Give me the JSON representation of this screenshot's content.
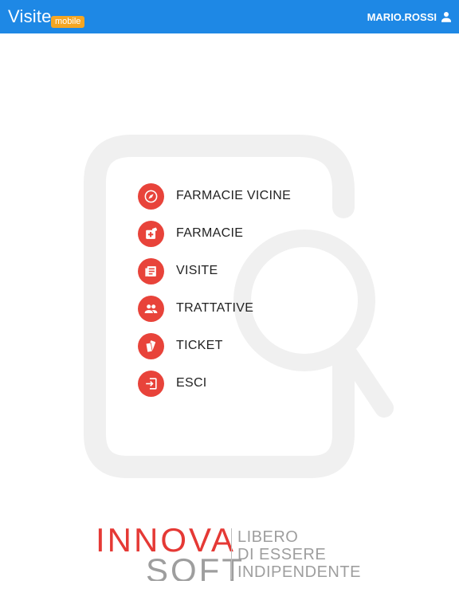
{
  "header": {
    "app_title": "Visite",
    "app_badge": "mobile",
    "username": "MARIO.ROSSI",
    "user_icon": "person-icon",
    "background_color": "#1e88e5",
    "badge_color": "#f5a623"
  },
  "menu": {
    "accent_color": "#e8433a",
    "items": [
      {
        "label": "FARMACIE VICINE",
        "icon": "compass-icon"
      },
      {
        "label": "FARMACIE",
        "icon": "pharmacy-icon"
      },
      {
        "label": "VISITE",
        "icon": "news-icon"
      },
      {
        "label": "TRATTATIVE",
        "icon": "people-icon"
      },
      {
        "label": "TICKET",
        "icon": "ticket-icon"
      },
      {
        "label": "ESCI",
        "icon": "exit-icon"
      }
    ]
  },
  "logo": {
    "brand_line1": "INNOVA",
    "brand_line2": "SOFT",
    "tagline": [
      "LIBERO",
      "DI ESSERE",
      "INDIPENDENTE"
    ]
  }
}
